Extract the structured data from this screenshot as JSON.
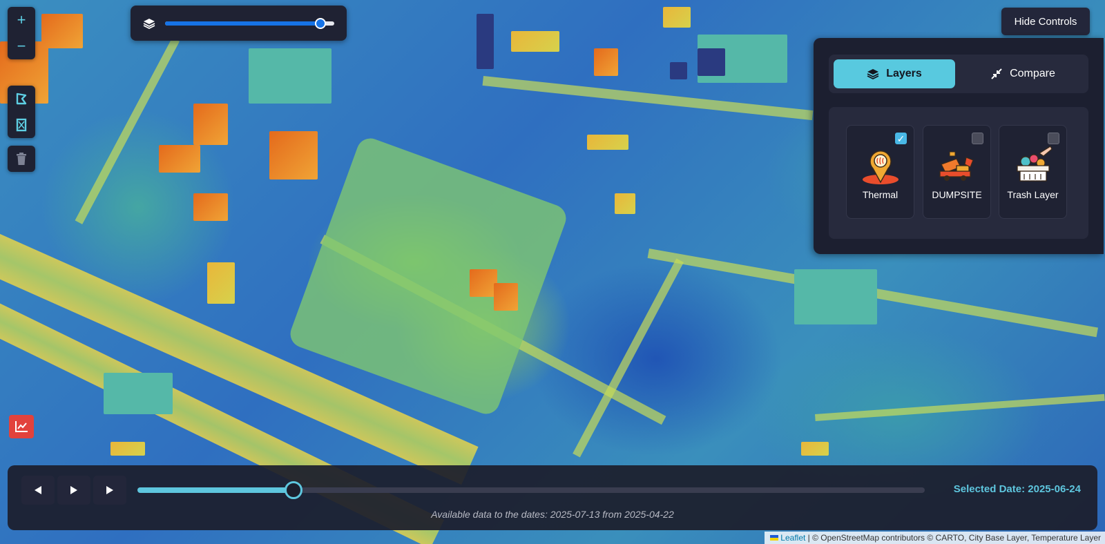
{
  "map": {
    "zoom_in": "+",
    "zoom_out": "−"
  },
  "opacity": {
    "value": 0.92
  },
  "hide_controls": "Hide Controls",
  "panel": {
    "tabs": [
      {
        "label": "Layers",
        "icon": "layers-icon",
        "active": true
      },
      {
        "label": "Compare",
        "icon": "compare-arrows-icon",
        "active": false
      }
    ],
    "layers": [
      {
        "label": "Thermal",
        "checked": true,
        "icon": "thermal-pin-icon"
      },
      {
        "label": "DUMPSITE",
        "checked": false,
        "icon": "dump-truck-icon"
      },
      {
        "label": "Trash Layer",
        "checked": false,
        "icon": "trash-bin-icon"
      }
    ]
  },
  "timeline": {
    "progress": 0.198,
    "selected_date": "Selected Date: 2025-06-24",
    "available": "Available data to the dates: 2025-07-13 from 2025-04-22"
  },
  "attribution": {
    "leaflet": "Leaflet",
    "rest": " | © OpenStreetMap contributors © CARTO, City Base Layer, Temperature Layer"
  },
  "colors": {
    "accent": "#58c9df",
    "panel_bg": "#1c1f30",
    "slider_blue": "#1673e6",
    "stats_red": "#e2423c"
  }
}
